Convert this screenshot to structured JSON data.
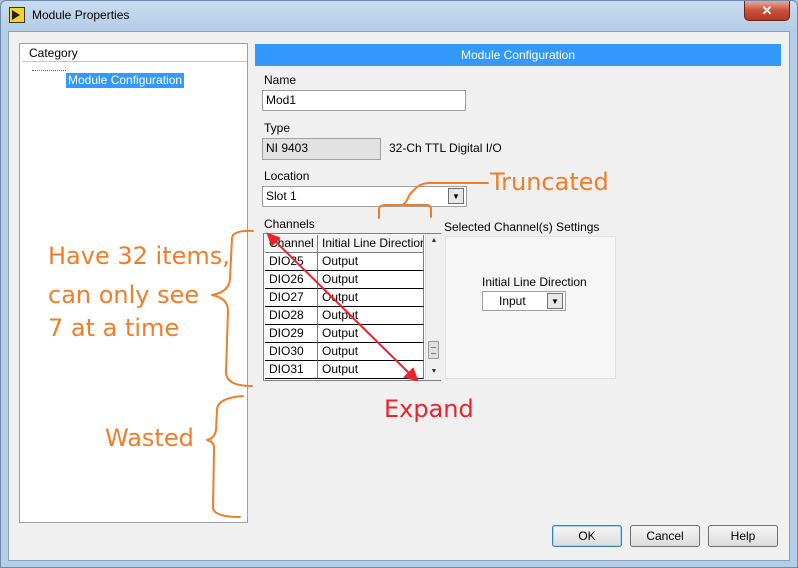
{
  "window": {
    "title": "Module Properties",
    "close_glyph": "✕"
  },
  "category": {
    "header": "Category",
    "items": [
      {
        "label": "Module Configuration",
        "selected": true
      }
    ]
  },
  "config": {
    "header": "Module Configuration",
    "name_label": "Name",
    "name_value": "Mod1",
    "type_label": "Type",
    "type_value": "NI 9403",
    "type_description": "32-Ch TTL Digital I/O",
    "location_label": "Location",
    "location_value": "Slot 1",
    "channels_label": "Channels",
    "table": {
      "columns": [
        "Channel",
        "Initial Line Direction"
      ],
      "rows": [
        [
          "DIO25",
          "Output"
        ],
        [
          "DIO26",
          "Output"
        ],
        [
          "DIO27",
          "Output"
        ],
        [
          "DIO28",
          "Output"
        ],
        [
          "DIO29",
          "Output"
        ],
        [
          "DIO30",
          "Output"
        ],
        [
          "DIO31",
          "Output"
        ]
      ]
    },
    "selected_settings": {
      "header": "Selected Channel(s) Settings",
      "direction_label": "Initial Line Direction",
      "direction_value": "Input"
    }
  },
  "buttons": {
    "ok": "OK",
    "cancel": "Cancel",
    "help": "Help"
  },
  "annotations": {
    "truncated": "Truncated",
    "items_line1": "Have 32 items,",
    "items_line2": "can only see",
    "items_line3": "7 at a time",
    "expand": "Expand",
    "wasted": "Wasted",
    "orange": "#f07d28",
    "red": "#e8252c"
  }
}
